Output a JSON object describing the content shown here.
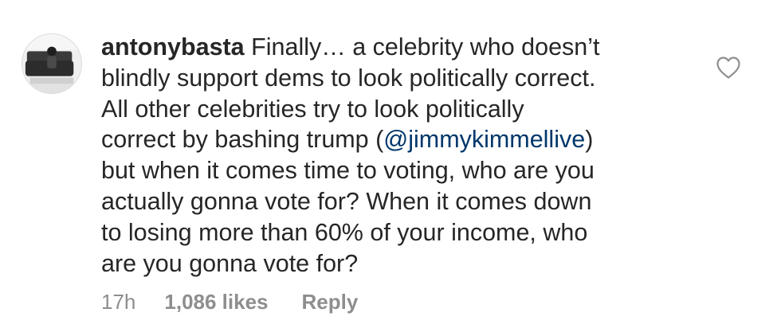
{
  "comment": {
    "username": "antonybasta",
    "lines": [
      {
        "pre": "Finally… a celebrity who doesn’t"
      },
      {
        "pre": "blindly support dems to look politically correct."
      },
      {
        "pre": "All other celebrities try to look politically"
      },
      {
        "pre": "correct by bashing trump (",
        "mention": "@jimmykimmellive",
        "post": ")"
      },
      {
        "pre": "but when it comes time to voting, who are you"
      },
      {
        "pre": "actually gonna vote for? When it comes down"
      },
      {
        "pre": "to losing more than 60% of your income, who"
      },
      {
        "pre": "are you gonna vote for?"
      }
    ],
    "time": "17h",
    "likes": "1,086 likes",
    "reply_label": "Reply",
    "like_icon": "heart-outline-icon"
  },
  "colors": {
    "text": "#262626",
    "mention": "#00376b",
    "meta": "#8e8e8e",
    "icon": "#8e8e8e"
  }
}
